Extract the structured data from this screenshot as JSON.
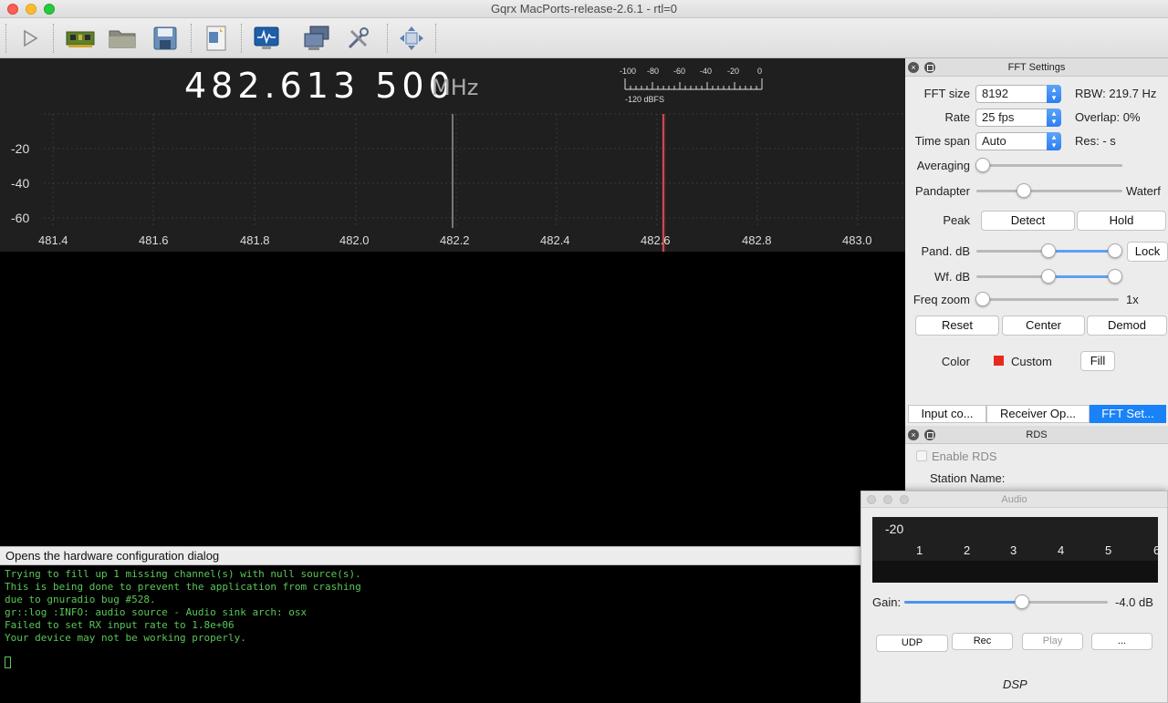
{
  "window": {
    "title": "Gqrx MacPorts-release-2.6.1 - rtl=0"
  },
  "toolbar": {
    "buttons": [
      {
        "name": "play-icon"
      },
      {
        "name": "hardware-card-icon"
      },
      {
        "name": "open-folder-icon"
      },
      {
        "name": "save-icon"
      },
      {
        "name": "remote-control-icon"
      },
      {
        "name": "monitor-pulse-icon"
      },
      {
        "name": "network-computers-icon"
      },
      {
        "name": "tools-icon"
      },
      {
        "name": "fullscreen-arrows-icon"
      }
    ]
  },
  "spectrum": {
    "frequency": "482.613 500",
    "unit": "MHz",
    "meter_ticks": [
      "-100",
      "-80",
      "-60",
      "-40",
      "-20",
      "0"
    ],
    "dbfs": "-120 dBFS",
    "y_labels": [
      "-20",
      "-40",
      "-60"
    ],
    "x_labels": [
      "481.4",
      "481.6",
      "481.8",
      "482.0",
      "482.2",
      "482.4",
      "482.6",
      "482.8",
      "483.0"
    ]
  },
  "status": {
    "text": "Opens the hardware configuration dialog"
  },
  "log": {
    "lines": [
      "Trying to fill up 1 missing channel(s) with null source(s).",
      "This is being done to prevent the application from crashing",
      "due to gnuradio bug #528.",
      "",
      "gr::log :INFO: audio source - Audio sink arch: osx",
      "",
      "Failed to set RX input rate to 1.8e+06",
      "Your device may not be working properly."
    ]
  },
  "fft": {
    "title": "FFT Settings",
    "fft_size_label": "FFT size",
    "fft_size": "8192",
    "rbw": "RBW: 219.7 Hz",
    "rate_label": "Rate",
    "rate": "25 fps",
    "overlap": "Overlap: 0%",
    "timespan_label": "Time span",
    "timespan": "Auto",
    "res": "Res: - s",
    "averaging_label": "Averaging",
    "pandapter_label": "Pandapter",
    "waterf_label": "Waterf",
    "peak_label": "Peak",
    "detect": "Detect",
    "hold": "Hold",
    "pand_db_label": "Pand. dB",
    "lock": "Lock",
    "wf_db_label": "Wf. dB",
    "freq_zoom_label": "Freq zoom",
    "freq_zoom_value": "1x",
    "reset": "Reset",
    "center": "Center",
    "demod": "Demod",
    "color_label": "Color",
    "color_value": "Custom",
    "color_swatch": "#e8281d",
    "fill": "Fill",
    "tabs": [
      "Input co...",
      "Receiver Op...",
      "FFT Set..."
    ]
  },
  "rds": {
    "title": "RDS",
    "enable": "Enable RDS",
    "station_name": "Station Name:"
  },
  "audio": {
    "title": "Audio",
    "db_label": "-20",
    "ticks": [
      "1",
      "2",
      "3",
      "4",
      "5",
      "6"
    ],
    "gain_label": "Gain:",
    "gain_value": "-4.0 dB",
    "gain_fraction": 0.58,
    "udp": "UDP",
    "rec": "Rec",
    "play": "Play",
    "more": "...",
    "dsp": "DSP"
  },
  "colors": {
    "accent": "#1a82f7",
    "log_text": "#59c757",
    "marker": "#e0606a"
  }
}
